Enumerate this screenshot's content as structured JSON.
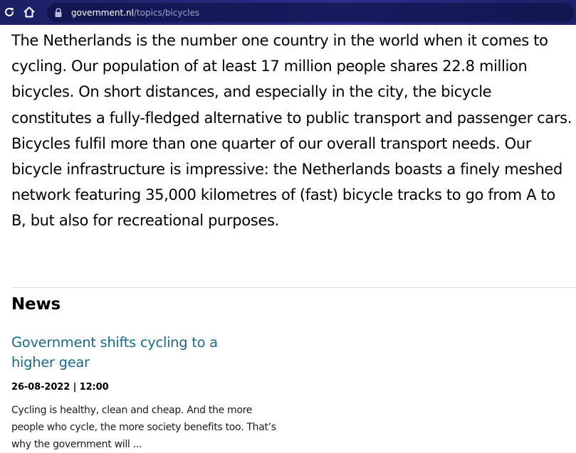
{
  "browser": {
    "url_domain": "government.nl",
    "url_path": "/topics/bicycles",
    "reload_icon": "reload-icon",
    "home_icon": "home-icon",
    "lock_icon": "lock-icon"
  },
  "intro": {
    "text": "The Netherlands is the number one country in the world when it comes to cycling. Our population of at least 17 million people shares 22.8 million bicycles. On short distances, and especially in the city, the bicycle constitutes a fully-fledged alternative to public transport and passenger cars. Bicycles fulfil more than one quarter of our overall transport needs. Our bicycle infrastructure is impressive: the Netherlands boasts a finely meshed network featuring 35,000 kilometres of (fast) bicycle tracks to go from A to B, but also for recreational purposes."
  },
  "news": {
    "heading": "News",
    "items": [
      {
        "title": "Government shifts cycling to a higher gear",
        "date": "26-08-2022 | 12:00",
        "excerpt": "Cycling is healthy, clean and cheap. And the more people who cycle, the more society benefits too. That’s why the government will ..."
      }
    ]
  },
  "colors": {
    "browser_bar": "#23297a",
    "link": "#1b6a87",
    "text": "#000000"
  }
}
